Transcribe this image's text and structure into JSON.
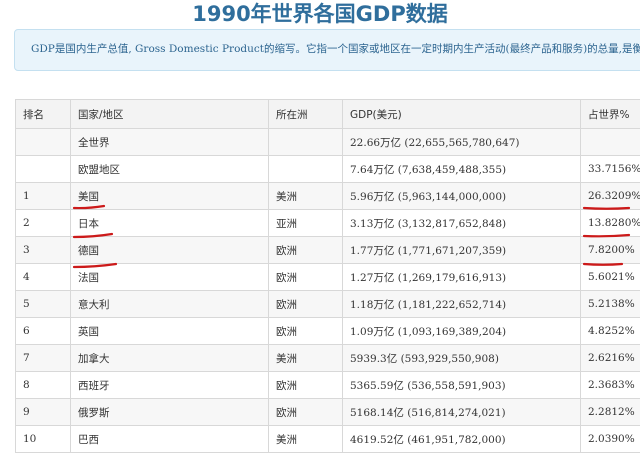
{
  "page": {
    "title": "1990年世界各国GDP数据",
    "intro": "GDP是国内生产总值, Gross Domestic Product的缩写。它指一个国家或地区在一定时期内生产活动(最终产品和服务)的总量,是衡量经济"
  },
  "table": {
    "headers": [
      "排名",
      "国家/地区",
      "所在洲",
      "GDP(美元)",
      "占世界%"
    ],
    "rows": [
      {
        "rank": "",
        "name": "全世界",
        "continent": "",
        "gdp": "22.66万亿 (22,655,565,780,647)",
        "share": ""
      },
      {
        "rank": "",
        "name": "欧盟地区",
        "continent": "",
        "gdp": "7.64万亿 (7,638,459,488,355)",
        "share": "33.7156%"
      },
      {
        "rank": "1",
        "name": "美国",
        "continent": "美洲",
        "gdp": "5.96万亿 (5,963,144,000,000)",
        "share": "26.3209%"
      },
      {
        "rank": "2",
        "name": "日本",
        "continent": "亚洲",
        "gdp": "3.13万亿 (3,132,817,652,848)",
        "share": "13.8280%"
      },
      {
        "rank": "3",
        "name": "德国",
        "continent": "欧洲",
        "gdp": "1.77万亿 (1,771,671,207,359)",
        "share": "7.8200%"
      },
      {
        "rank": "4",
        "name": "法国",
        "continent": "欧洲",
        "gdp": "1.27万亿 (1,269,179,616,913)",
        "share": "5.6021%"
      },
      {
        "rank": "5",
        "name": "意大利",
        "continent": "欧洲",
        "gdp": "1.18万亿 (1,181,222,652,714)",
        "share": "5.2138%"
      },
      {
        "rank": "6",
        "name": "英国",
        "continent": "欧洲",
        "gdp": "1.09万亿 (1,093,169,389,204)",
        "share": "4.8252%"
      },
      {
        "rank": "7",
        "name": "加拿大",
        "continent": "美洲",
        "gdp": "5939.3亿 (593,929,550,908)",
        "share": "2.6216%"
      },
      {
        "rank": "8",
        "name": "西班牙",
        "continent": "欧洲",
        "gdp": "5365.59亿 (536,558,591,903)",
        "share": "2.3683%"
      },
      {
        "rank": "9",
        "name": "俄罗斯",
        "continent": "欧洲",
        "gdp": "5168.14亿 (516,814,274,021)",
        "share": "2.2812%"
      },
      {
        "rank": "10",
        "name": "巴西",
        "continent": "美洲",
        "gdp": "4619.52亿 (461,951,782,000)",
        "share": "2.0390%"
      }
    ]
  },
  "annotations": {
    "underline_color": "#cc1a1a"
  }
}
